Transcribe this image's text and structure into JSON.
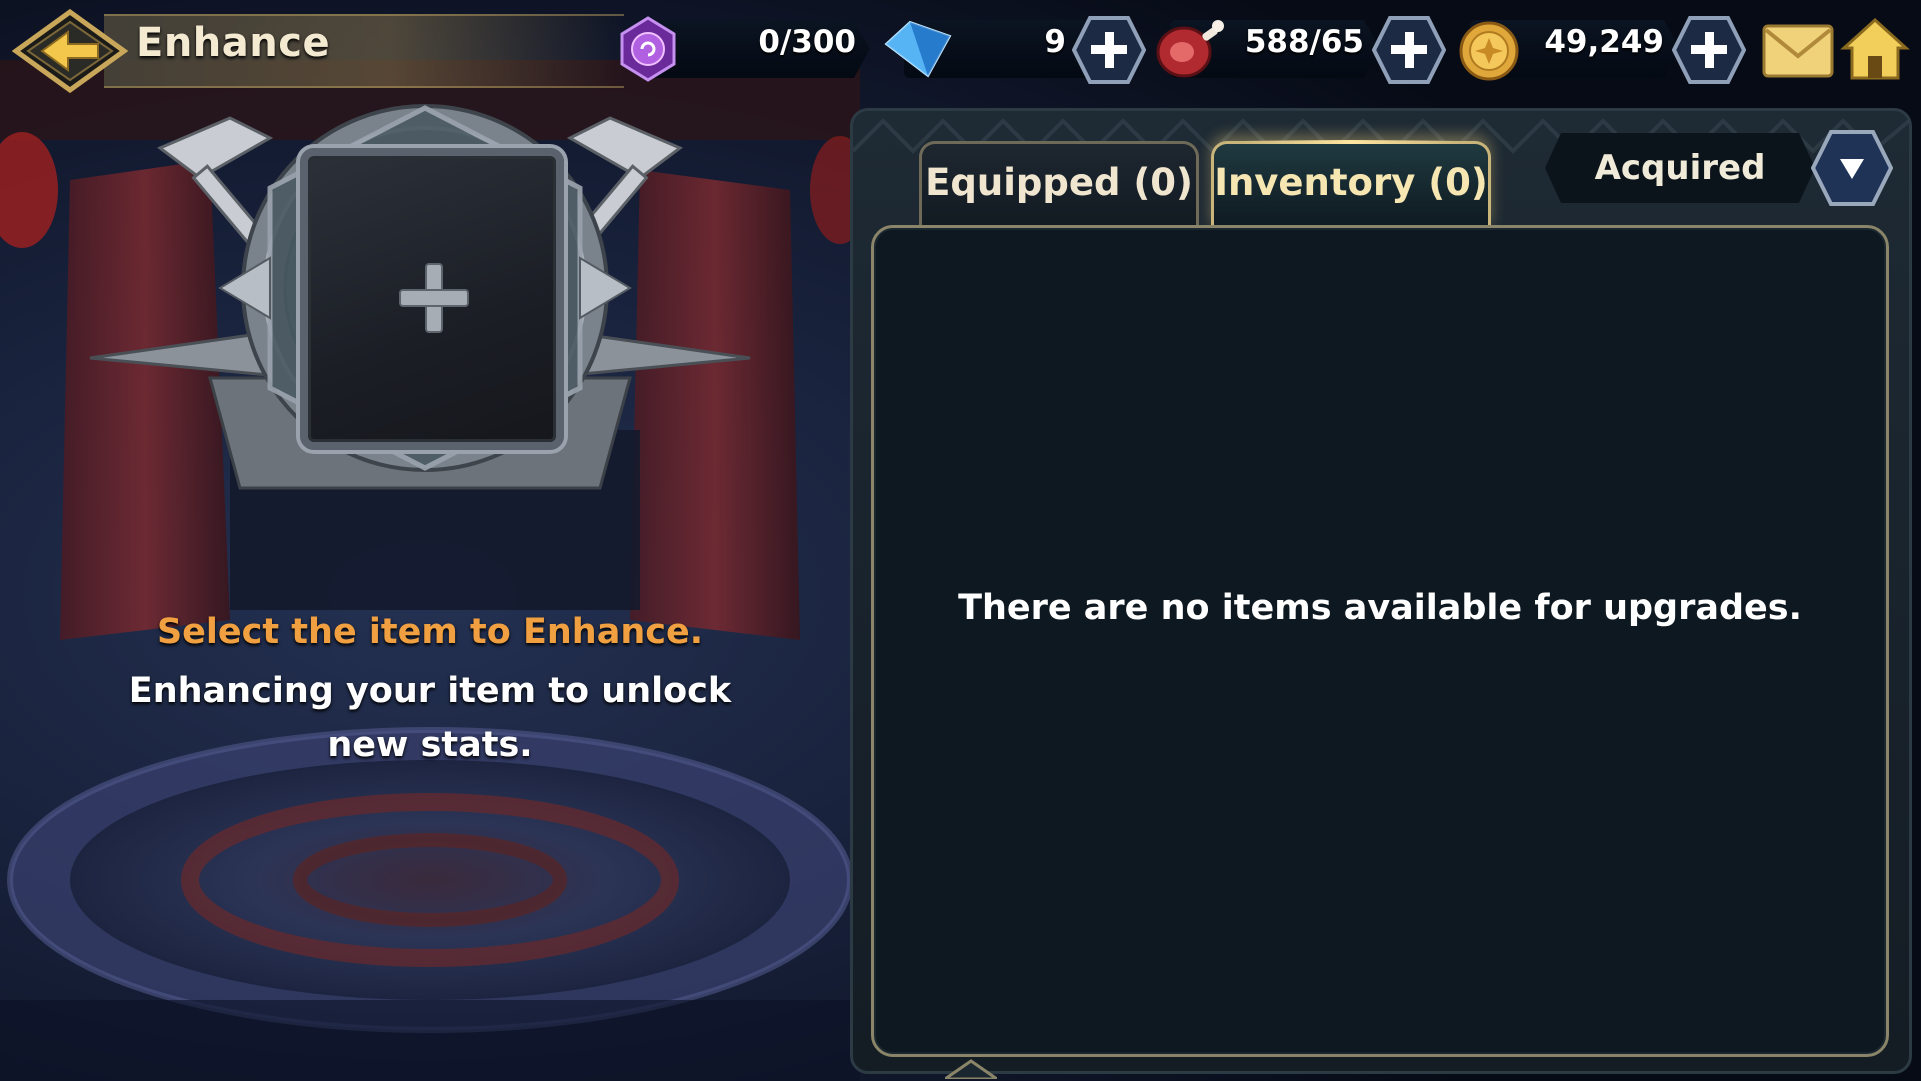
{
  "header": {
    "title": "Enhance",
    "back_icon": "back-arrow-icon",
    "accent_color": "#e8c060"
  },
  "resources": [
    {
      "id": "essence",
      "icon": "purple-essence-gem-icon",
      "value": "0/300",
      "has_plus": false
    },
    {
      "id": "crystals",
      "icon": "blue-crystal-icon",
      "value": "9",
      "has_plus": true
    },
    {
      "id": "stamina",
      "icon": "meat-icon",
      "value": "588/65",
      "has_plus": true
    },
    {
      "id": "gold",
      "icon": "gold-coin-icon",
      "value": "49,249",
      "has_plus": true
    }
  ],
  "top_icons": {
    "mail": "mail-envelope-icon",
    "home": "home-icon"
  },
  "enhance_slot": {
    "icon": "add-plus-icon",
    "hint_primary": "Select the item to Enhance.",
    "hint_secondary": "Enhancing your item to unlock new stats."
  },
  "tabs": [
    {
      "label": "Equipped (0)",
      "active": false
    },
    {
      "label": "Inventory (0)",
      "active": true
    }
  ],
  "sort": {
    "selected": "Acquired",
    "toggle_icon": "dropdown-triangle-icon"
  },
  "list": {
    "empty_message": "There are no items available for upgrades."
  },
  "colors": {
    "hint_orange": "#f0a040",
    "panel_bg": "#0e1820",
    "active_tab_border": "#c9b47a"
  }
}
